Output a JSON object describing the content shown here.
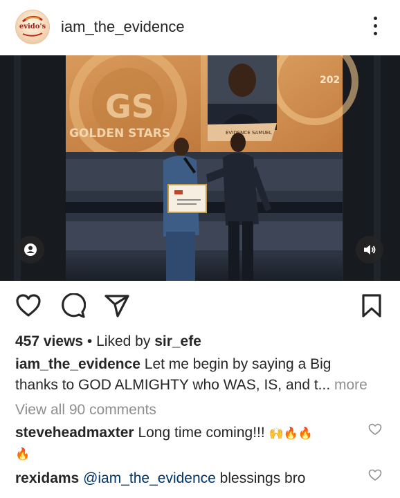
{
  "post": {
    "username": "iam_the_evidence",
    "avatar_text": "evido's"
  },
  "video": {
    "screen_text_left": "GOLDEN STARS",
    "screen_text_name": "EVIDENCE SAMUEL",
    "screen_text_year": "202"
  },
  "stats": {
    "views": "457 views",
    "separator": " • ",
    "liked_by_prefix": "Liked by ",
    "liked_by_user": "sir_efe"
  },
  "caption": {
    "username": "iam_the_evidence",
    "text_line1": " Let me begin by saying a Big",
    "text_line2": "thanks to GOD ALMIGHTY who WAS, IS, and t...",
    "more_label": " more"
  },
  "comments_link": "View all 90 comments",
  "comments": [
    {
      "username": "steveheadmaxter",
      "text": " Long time coming!!! ",
      "emojis": "🙌🔥🔥",
      "emojis_line2": "🔥"
    },
    {
      "username": "rexidams",
      "mention": " @iam_the_evidence",
      "text": " blessings bro"
    }
  ],
  "colors": {
    "text": "#262626",
    "muted": "#8e8e8e",
    "mention": "#003569",
    "background": "#ffffff"
  },
  "icons": [
    "more-icon",
    "user-tag-icon",
    "sound-icon",
    "heart-icon",
    "comment-icon",
    "share-icon",
    "bookmark-icon"
  ]
}
